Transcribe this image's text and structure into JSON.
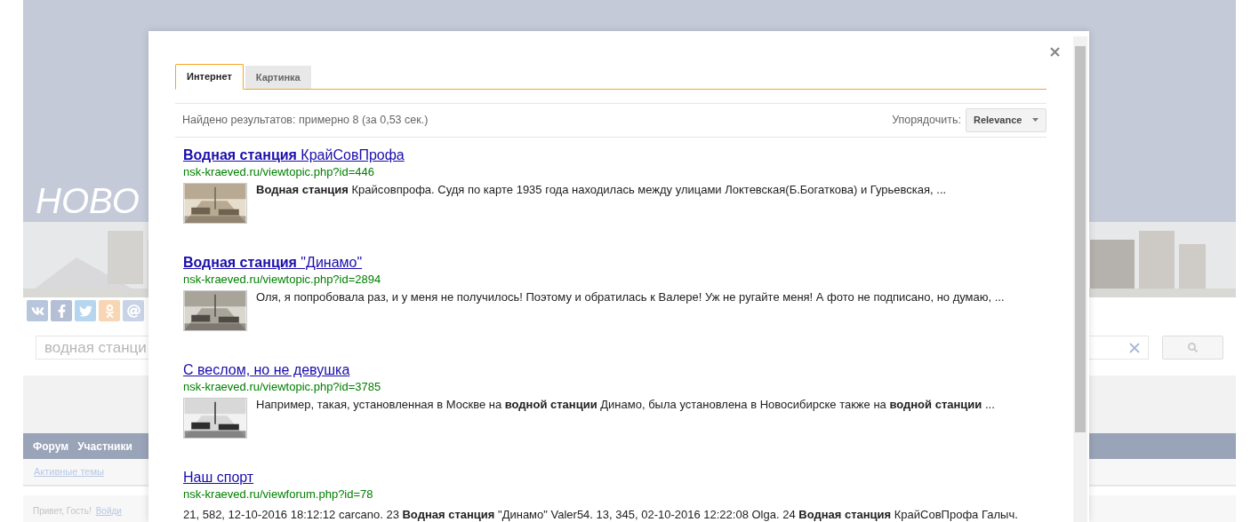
{
  "background_page": {
    "logo": "НОВО",
    "search": {
      "value": "водная станци"
    },
    "nav": [
      "Форум",
      "Участники"
    ],
    "subnav": [
      "Активные темы"
    ],
    "greeting": "Привет, Гость!",
    "login_link": "Войди"
  },
  "dialog": {
    "tabs": [
      {
        "label": "Интернет",
        "selected": true
      },
      {
        "label": "Картинка",
        "selected": false
      }
    ],
    "result_count": "Найдено результатов: примерно 8 (за 0,53 сек.)",
    "sort": {
      "label": "Упорядочить:",
      "value": "Relevance"
    },
    "results": [
      {
        "title": "**Водная станция** КрайСовПрофа",
        "url": "nsk-kraeved.ru/viewtopic.php?id=446",
        "snippet": "**Водная станция** Крайсовпрофа. Судя по карте 1935 года находилась между улицами Локтевская(Б.Богаткова) и Гурьевская, ..."
      },
      {
        "title": "**Водная станция** \"Динамо\"",
        "url": "nsk-kraeved.ru/viewtopic.php?id=2894",
        "snippet": "Оля, я попробовала раз, и у меня не получилось! Поэтому и обратилась к Валере! Уж не ругайте меня! А фото не подписано, но думаю, ..."
      },
      {
        "title": "С веслом, но не девушка",
        "url": "nsk-kraeved.ru/viewtopic.php?id=3785",
        "snippet": "Например, такая, установленная в Москве на **водной станции** Динамо, была установлена в Новосибирске также на **водной станции** ..."
      },
      {
        "title": "Наш спорт",
        "url": "nsk-kraeved.ru/viewforum.php?id=78",
        "snippet": "21, 582, 12-10-2016 18:12:12 carcano. 23 **Водная станция** \"Динамо\" Valer54. 13, 345, 02-10-2016 12:22:08 Olga. 24 **Водная станция** КрайСовПрофа Галыч."
      }
    ]
  }
}
